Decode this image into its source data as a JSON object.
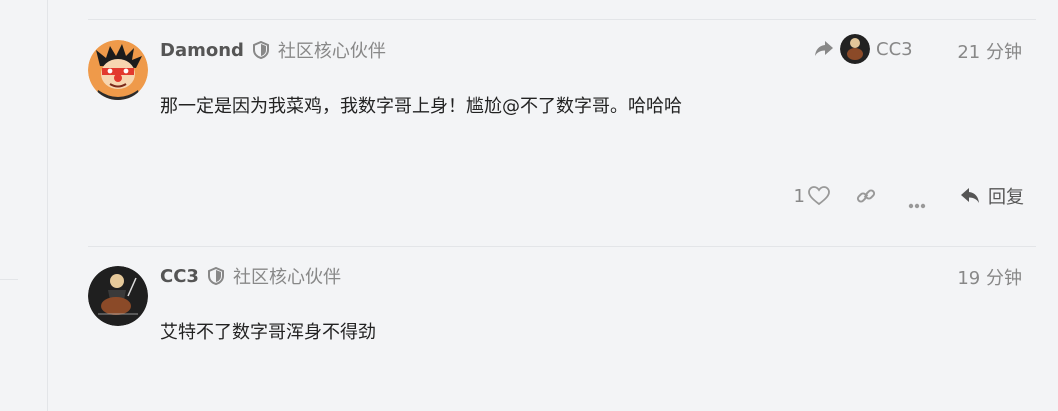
{
  "posts": [
    {
      "author": "Damond",
      "user_title": "社区核心伙伴",
      "content": "那一定是因为我菜鸡，我数字哥上身！尴尬@不了数字哥。哈哈哈",
      "time": "21 分钟",
      "reply_to": {
        "name": "CC3"
      },
      "likes": "1",
      "reply_label": "回复"
    },
    {
      "author": "CC3",
      "user_title": "社区核心伙伴",
      "content": "艾特不了数字哥浑身不得劲",
      "time": "19 分钟"
    }
  ],
  "colors": {
    "text_muted": "#888888",
    "username": "#555555",
    "background": "#f3f4f6",
    "divider": "#e3e5e8"
  },
  "icons": {
    "shield": "shield-icon",
    "reply_arrow": "share-arrow-icon",
    "like": "heart-icon",
    "link": "link-icon",
    "more": "ellipsis-icon",
    "reply": "reply-icon"
  }
}
